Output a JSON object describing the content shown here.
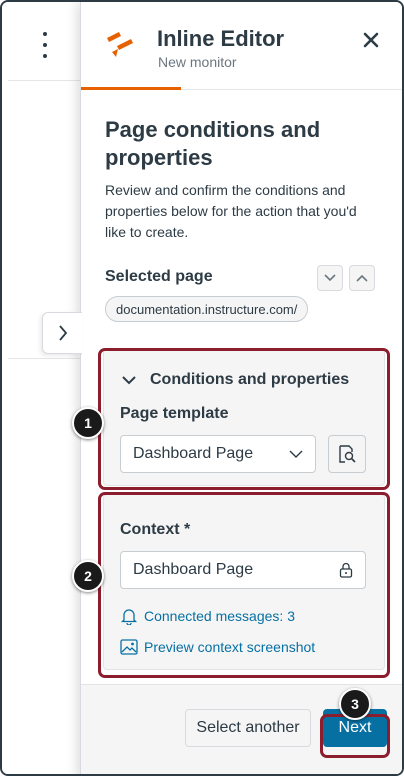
{
  "header": {
    "title": "Inline Editor",
    "subtitle": "New monitor",
    "close_icon": "close-icon",
    "accent_color": "#e66000"
  },
  "main": {
    "title": "Page conditions and properties",
    "description": "Review and confirm the conditions and properties below for the action that you'd like to create.",
    "selected_page_label": "Selected page",
    "selected_page_url": "documentation.instructure.com/"
  },
  "conditions": {
    "section_label": "Conditions and properties",
    "page_template_label": "Page template",
    "page_template_value": "Dashboard Page"
  },
  "context": {
    "label": "Context *",
    "value": "Dashboard Page",
    "connected_messages": "Connected messages: 3",
    "preview_link": "Preview context screenshot"
  },
  "footer": {
    "secondary_label": "Select another",
    "primary_label": "Next"
  },
  "steps": [
    "1",
    "2",
    "3"
  ],
  "colors": {
    "primary": "#0770a3",
    "highlight": "#8b1d2c",
    "text": "#2d3b45"
  }
}
